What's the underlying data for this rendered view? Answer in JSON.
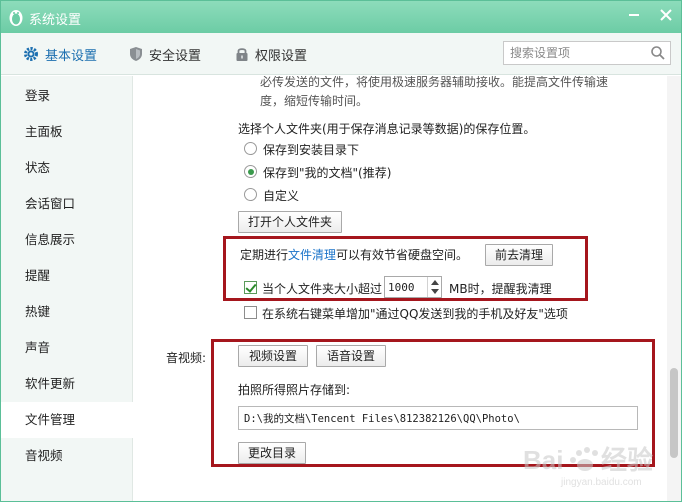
{
  "window": {
    "title": "系统设置"
  },
  "tabs": [
    {
      "label": "基本设置",
      "icon": "gear-icon",
      "active": true
    },
    {
      "label": "安全设置",
      "icon": "shield-icon",
      "active": false
    },
    {
      "label": "权限设置",
      "icon": "lock-icon",
      "active": false
    }
  ],
  "search": {
    "placeholder": "搜索设置项"
  },
  "sidebar": {
    "items": [
      {
        "label": "登录"
      },
      {
        "label": "主面板"
      },
      {
        "label": "状态"
      },
      {
        "label": "会话窗口"
      },
      {
        "label": "信息展示"
      },
      {
        "label": "提醒"
      },
      {
        "label": "热键"
      },
      {
        "label": "声音"
      },
      {
        "label": "软件更新"
      },
      {
        "label": "文件管理",
        "active": true
      },
      {
        "label": "音视频"
      }
    ]
  },
  "file_management": {
    "note_line1": "必传发送的文件，将使用极速服务器辅助接收。能提高文件传输速",
    "note_line2": "度，缩短传输时间。",
    "folder_prompt": "选择个人文件夹(用于保存消息记录等数据)的保存位置。",
    "options": [
      {
        "label": "保存到安装目录下",
        "checked": false
      },
      {
        "label": "保存到\"我的文档\"(推荐)",
        "checked": true
      },
      {
        "label": "自定义",
        "checked": false
      }
    ],
    "open_folder_button": "打开个人文件夹",
    "cleanup_prefix": "定期进行",
    "cleanup_link": "文件清理",
    "cleanup_suffix": "可以有效节省硬盘空间。",
    "cleanup_button": "前去清理",
    "size_limit": {
      "label": "当个人文件夹大小超过",
      "value": "1000",
      "unit_suffix": "MB时，提醒我清理",
      "checked": true
    },
    "context_menu_option": {
      "label": "在系统右键菜单增加\"通过QQ发送到我的手机及好友\"选项",
      "checked": false
    }
  },
  "av": {
    "section_label": "音视频:",
    "video_button": "视频设置",
    "voice_button": "语音设置",
    "photo_label": "拍照所得照片存储到:",
    "photo_path": "D:\\我的文档\\Tencent Files\\812382126\\QQ\\Photo\\",
    "change_dir_button": "更改目录"
  },
  "colors": {
    "titlebar": "#6ccca5",
    "highlight": "#a5161d",
    "link": "#1a73c9",
    "active_tab": "#1c6fb0"
  }
}
